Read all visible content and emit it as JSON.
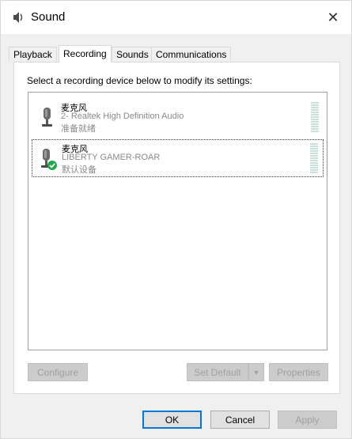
{
  "window": {
    "title": "Sound",
    "close_glyph": "✕"
  },
  "tabs": [
    {
      "label": "Playback",
      "active": false
    },
    {
      "label": "Recording",
      "active": true
    },
    {
      "label": "Sounds",
      "active": false
    },
    {
      "label": "Communications",
      "active": false
    }
  ],
  "panel": {
    "instruction": "Select a recording device below to modify its settings:"
  },
  "devices": [
    {
      "name": "麦克风",
      "description": "2- Realtek High Definition Audio",
      "status": "准备就绪",
      "icon": "microphone-icon",
      "selected": false,
      "is_default": false
    },
    {
      "name": "麦克风",
      "description": "LIBERTY GAMER-ROAR",
      "status": "默认设备",
      "icon": "microphone-default-icon",
      "selected": true,
      "is_default": true
    }
  ],
  "panel_buttons": {
    "configure": "Configure",
    "set_default": "Set Default",
    "properties": "Properties"
  },
  "dialog_buttons": {
    "ok": "OK",
    "cancel": "Cancel",
    "apply": "Apply"
  },
  "colors": {
    "default_check": "#1fa849",
    "focus_border": "#0078d7"
  }
}
